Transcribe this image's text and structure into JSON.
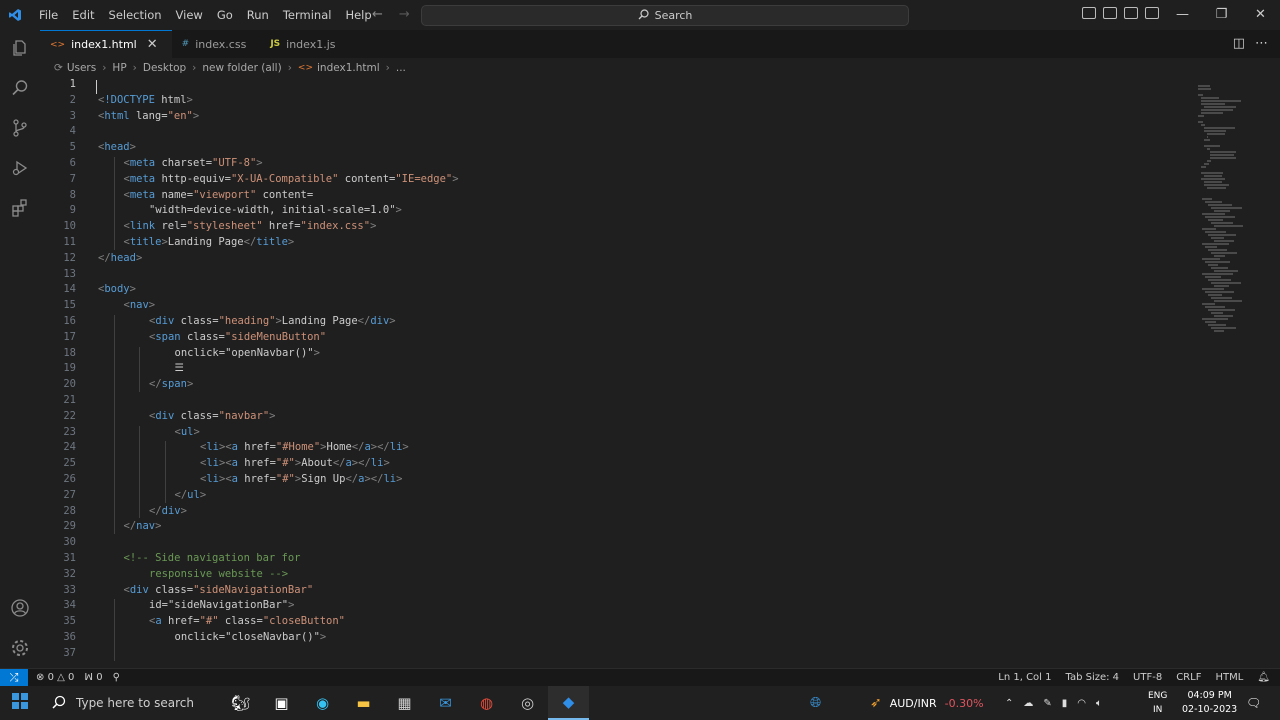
{
  "menu": [
    "File",
    "Edit",
    "Selection",
    "View",
    "Go",
    "Run",
    "Terminal",
    "Help"
  ],
  "search": {
    "label": "Search"
  },
  "tabs": [
    {
      "label": "index1.html",
      "icon": "html-file-icon",
      "active": true
    },
    {
      "label": "index.css",
      "icon": "css-file-icon",
      "active": false
    },
    {
      "label": "index1.js",
      "icon": "js-file-icon",
      "active": false
    }
  ],
  "tab_icons": {
    "css": "#",
    "js": "JS",
    "html": "<>"
  },
  "breadcrumb": [
    "Users",
    "HP",
    "Desktop",
    "new folder (all)",
    "index1.html",
    "..."
  ],
  "code_lines": [
    {
      "n": "1",
      "indent": 0,
      "text": ""
    },
    {
      "n": "2",
      "indent": 0,
      "text": "<!DOCTYPE html>"
    },
    {
      "n": "3",
      "indent": 0,
      "text": "<html lang=\"en\">"
    },
    {
      "n": "4",
      "indent": 0,
      "text": ""
    },
    {
      "n": "5",
      "indent": 0,
      "text": "<head>"
    },
    {
      "n": "6",
      "indent": 1,
      "text": "<meta charset=\"UTF-8\">"
    },
    {
      "n": "7",
      "indent": 1,
      "text": "<meta http-equiv=\"X-UA-Compatible\" content=\"IE=edge\">"
    },
    {
      "n": "8",
      "indent": 1,
      "text": "<meta name=\"viewport\" content="
    },
    {
      "n": "9",
      "indent": 2,
      "text": "\"width=device-width, initial-scale=1.0\">"
    },
    {
      "n": "10",
      "indent": 1,
      "text": "<link rel=\"stylesheet\" href=\"index.css\">"
    },
    {
      "n": "11",
      "indent": 1,
      "text": "<title>Landing Page</title>"
    },
    {
      "n": "12",
      "indent": 0,
      "text": "</head>"
    },
    {
      "n": "13",
      "indent": 0,
      "text": ""
    },
    {
      "n": "14",
      "indent": 0,
      "text": "<body>"
    },
    {
      "n": "15",
      "indent": 1,
      "text": "<nav>"
    },
    {
      "n": "16",
      "indent": 2,
      "text": "<div class=\"heading\">Landing Page</div>"
    },
    {
      "n": "17",
      "indent": 2,
      "text": "<span class=\"sideMenuButton\""
    },
    {
      "n": "18",
      "indent": 3,
      "text": "onclick=\"openNavbar()\">"
    },
    {
      "n": "19",
      "indent": 3,
      "text": "☰"
    },
    {
      "n": "20",
      "indent": 2,
      "text": "</span>"
    },
    {
      "n": "21",
      "indent": 0,
      "text": ""
    },
    {
      "n": "22",
      "indent": 2,
      "text": "<div class=\"navbar\">"
    },
    {
      "n": "23",
      "indent": 3,
      "text": "<ul>"
    },
    {
      "n": "24",
      "indent": 4,
      "text": "<li><a href=\"#Home\">Home</a></li>"
    },
    {
      "n": "25",
      "indent": 4,
      "text": "<li><a href=\"#\">About</a></li>"
    },
    {
      "n": "26",
      "indent": 4,
      "text": "<li><a href=\"#\">Sign Up</a></li>"
    },
    {
      "n": "27",
      "indent": 3,
      "text": "</ul>"
    },
    {
      "n": "28",
      "indent": 2,
      "text": "</div>"
    },
    {
      "n": "29",
      "indent": 1,
      "text": "</nav>"
    },
    {
      "n": "30",
      "indent": 0,
      "text": ""
    },
    {
      "n": "31",
      "indent": 1,
      "text": "<!-- Side navigation bar for"
    },
    {
      "n": "32",
      "indent": 2,
      "text": "responsive website -->"
    },
    {
      "n": "33",
      "indent": 1,
      "text": "<div class=\"sideNavigationBar\""
    },
    {
      "n": "34",
      "indent": 2,
      "text": "id=\"sideNavigationBar\">"
    },
    {
      "n": "35",
      "indent": 2,
      "text": "<a href=\"#\" class=\"closeButton\""
    },
    {
      "n": "36",
      "indent": 3,
      "text": "onclick=\"closeNavbar()\">"
    },
    {
      "n": "37",
      "indent": 0,
      "text": ""
    }
  ],
  "status": {
    "errors": "0",
    "warnings": "0",
    "ports": "0",
    "position": "Ln 1, Col 1",
    "tab_size": "Tab Size: 4",
    "encoding": "UTF-8",
    "eol": "CRLF",
    "language": "HTML"
  },
  "taskbar": {
    "search_placeholder": "Type here to search",
    "ticker_name": "AUD/INR",
    "ticker_change": "-0.30%",
    "lang1": "ENG",
    "lang2": "IN",
    "time": "04:09 PM",
    "date": "02-10-2023"
  },
  "colors": {
    "accent": "#0078d4",
    "tag": "#569cd6",
    "attr": "#9cdcfe",
    "string": "#ce9178",
    "comment": "#6a9955",
    "text": "#cccccc"
  }
}
